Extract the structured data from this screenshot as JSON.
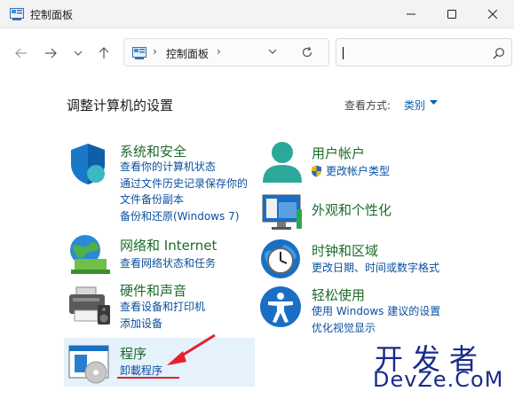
{
  "window": {
    "title": "控制面板",
    "controls": {
      "minimize": "minimize-icon",
      "maximize": "maximize-icon",
      "close": "close-icon"
    }
  },
  "nav": {
    "back": "back-arrow-icon",
    "forward": "forward-arrow-icon",
    "recent": "chevron-down-icon",
    "up": "up-arrow-icon"
  },
  "address": {
    "sep": "›",
    "crumb": "控制面板",
    "sep_end": "›"
  },
  "search": {
    "placeholder": "",
    "value": ""
  },
  "header": {
    "title": "调整计算机的设置",
    "view_by_label": "查看方式:",
    "view_by_value": "类别"
  },
  "categories_left": [
    {
      "title": "系统和安全",
      "links": [
        "查看你的计算机状态",
        "通过文件历史记录保存你的",
        "文件备份副本",
        "备份和还原(Windows 7)"
      ]
    },
    {
      "title": "网络和 Internet",
      "links": [
        "查看网络状态和任务"
      ]
    },
    {
      "title": "硬件和声音",
      "links": [
        "查看设备和打印机",
        "添加设备"
      ]
    },
    {
      "title": "程序",
      "links": [
        "卸載程序"
      ]
    }
  ],
  "categories_right": [
    {
      "title": "用户帐户",
      "links": [
        "更改帐户类型"
      ]
    },
    {
      "title": "外观和个性化",
      "links": []
    },
    {
      "title": "时钟和区域",
      "links": [
        "更改日期、时间或数字格式"
      ]
    },
    {
      "title": "轻松使用",
      "links": [
        "使用 Windows 建议的设置",
        "优化视觉显示"
      ]
    }
  ],
  "watermark": {
    "line1": "开发者",
    "line2": "DevZe.CoM"
  },
  "colors": {
    "accent_link": "#0a50a0",
    "category_title": "#1c6b2a",
    "annotation": "#e5202a",
    "highlight": "#e5f1fb"
  }
}
